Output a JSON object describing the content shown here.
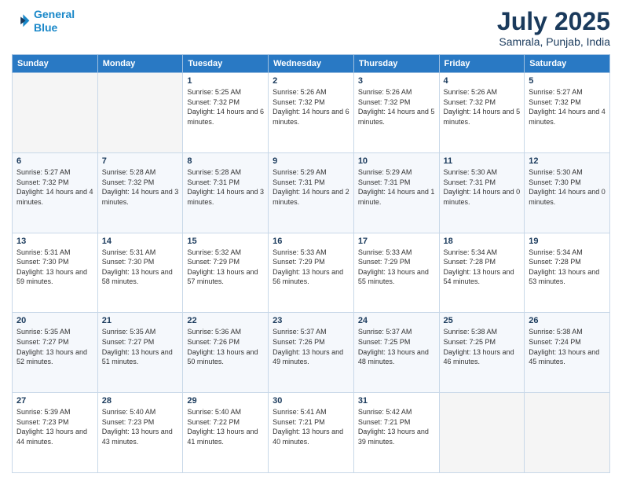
{
  "logo": {
    "line1": "General",
    "line2": "Blue"
  },
  "header": {
    "title": "July 2025",
    "subtitle": "Samrala, Punjab, India"
  },
  "weekdays": [
    "Sunday",
    "Monday",
    "Tuesday",
    "Wednesday",
    "Thursday",
    "Friday",
    "Saturday"
  ],
  "weeks": [
    [
      {
        "day": "",
        "info": ""
      },
      {
        "day": "",
        "info": ""
      },
      {
        "day": "1",
        "info": "Sunrise: 5:25 AM\nSunset: 7:32 PM\nDaylight: 14 hours and 6 minutes."
      },
      {
        "day": "2",
        "info": "Sunrise: 5:26 AM\nSunset: 7:32 PM\nDaylight: 14 hours and 6 minutes."
      },
      {
        "day": "3",
        "info": "Sunrise: 5:26 AM\nSunset: 7:32 PM\nDaylight: 14 hours and 5 minutes."
      },
      {
        "day": "4",
        "info": "Sunrise: 5:26 AM\nSunset: 7:32 PM\nDaylight: 14 hours and 5 minutes."
      },
      {
        "day": "5",
        "info": "Sunrise: 5:27 AM\nSunset: 7:32 PM\nDaylight: 14 hours and 4 minutes."
      }
    ],
    [
      {
        "day": "6",
        "info": "Sunrise: 5:27 AM\nSunset: 7:32 PM\nDaylight: 14 hours and 4 minutes."
      },
      {
        "day": "7",
        "info": "Sunrise: 5:28 AM\nSunset: 7:32 PM\nDaylight: 14 hours and 3 minutes."
      },
      {
        "day": "8",
        "info": "Sunrise: 5:28 AM\nSunset: 7:31 PM\nDaylight: 14 hours and 3 minutes."
      },
      {
        "day": "9",
        "info": "Sunrise: 5:29 AM\nSunset: 7:31 PM\nDaylight: 14 hours and 2 minutes."
      },
      {
        "day": "10",
        "info": "Sunrise: 5:29 AM\nSunset: 7:31 PM\nDaylight: 14 hours and 1 minute."
      },
      {
        "day": "11",
        "info": "Sunrise: 5:30 AM\nSunset: 7:31 PM\nDaylight: 14 hours and 0 minutes."
      },
      {
        "day": "12",
        "info": "Sunrise: 5:30 AM\nSunset: 7:30 PM\nDaylight: 14 hours and 0 minutes."
      }
    ],
    [
      {
        "day": "13",
        "info": "Sunrise: 5:31 AM\nSunset: 7:30 PM\nDaylight: 13 hours and 59 minutes."
      },
      {
        "day": "14",
        "info": "Sunrise: 5:31 AM\nSunset: 7:30 PM\nDaylight: 13 hours and 58 minutes."
      },
      {
        "day": "15",
        "info": "Sunrise: 5:32 AM\nSunset: 7:29 PM\nDaylight: 13 hours and 57 minutes."
      },
      {
        "day": "16",
        "info": "Sunrise: 5:33 AM\nSunset: 7:29 PM\nDaylight: 13 hours and 56 minutes."
      },
      {
        "day": "17",
        "info": "Sunrise: 5:33 AM\nSunset: 7:29 PM\nDaylight: 13 hours and 55 minutes."
      },
      {
        "day": "18",
        "info": "Sunrise: 5:34 AM\nSunset: 7:28 PM\nDaylight: 13 hours and 54 minutes."
      },
      {
        "day": "19",
        "info": "Sunrise: 5:34 AM\nSunset: 7:28 PM\nDaylight: 13 hours and 53 minutes."
      }
    ],
    [
      {
        "day": "20",
        "info": "Sunrise: 5:35 AM\nSunset: 7:27 PM\nDaylight: 13 hours and 52 minutes."
      },
      {
        "day": "21",
        "info": "Sunrise: 5:35 AM\nSunset: 7:27 PM\nDaylight: 13 hours and 51 minutes."
      },
      {
        "day": "22",
        "info": "Sunrise: 5:36 AM\nSunset: 7:26 PM\nDaylight: 13 hours and 50 minutes."
      },
      {
        "day": "23",
        "info": "Sunrise: 5:37 AM\nSunset: 7:26 PM\nDaylight: 13 hours and 49 minutes."
      },
      {
        "day": "24",
        "info": "Sunrise: 5:37 AM\nSunset: 7:25 PM\nDaylight: 13 hours and 48 minutes."
      },
      {
        "day": "25",
        "info": "Sunrise: 5:38 AM\nSunset: 7:25 PM\nDaylight: 13 hours and 46 minutes."
      },
      {
        "day": "26",
        "info": "Sunrise: 5:38 AM\nSunset: 7:24 PM\nDaylight: 13 hours and 45 minutes."
      }
    ],
    [
      {
        "day": "27",
        "info": "Sunrise: 5:39 AM\nSunset: 7:23 PM\nDaylight: 13 hours and 44 minutes."
      },
      {
        "day": "28",
        "info": "Sunrise: 5:40 AM\nSunset: 7:23 PM\nDaylight: 13 hours and 43 minutes."
      },
      {
        "day": "29",
        "info": "Sunrise: 5:40 AM\nSunset: 7:22 PM\nDaylight: 13 hours and 41 minutes."
      },
      {
        "day": "30",
        "info": "Sunrise: 5:41 AM\nSunset: 7:21 PM\nDaylight: 13 hours and 40 minutes."
      },
      {
        "day": "31",
        "info": "Sunrise: 5:42 AM\nSunset: 7:21 PM\nDaylight: 13 hours and 39 minutes."
      },
      {
        "day": "",
        "info": ""
      },
      {
        "day": "",
        "info": ""
      }
    ]
  ]
}
